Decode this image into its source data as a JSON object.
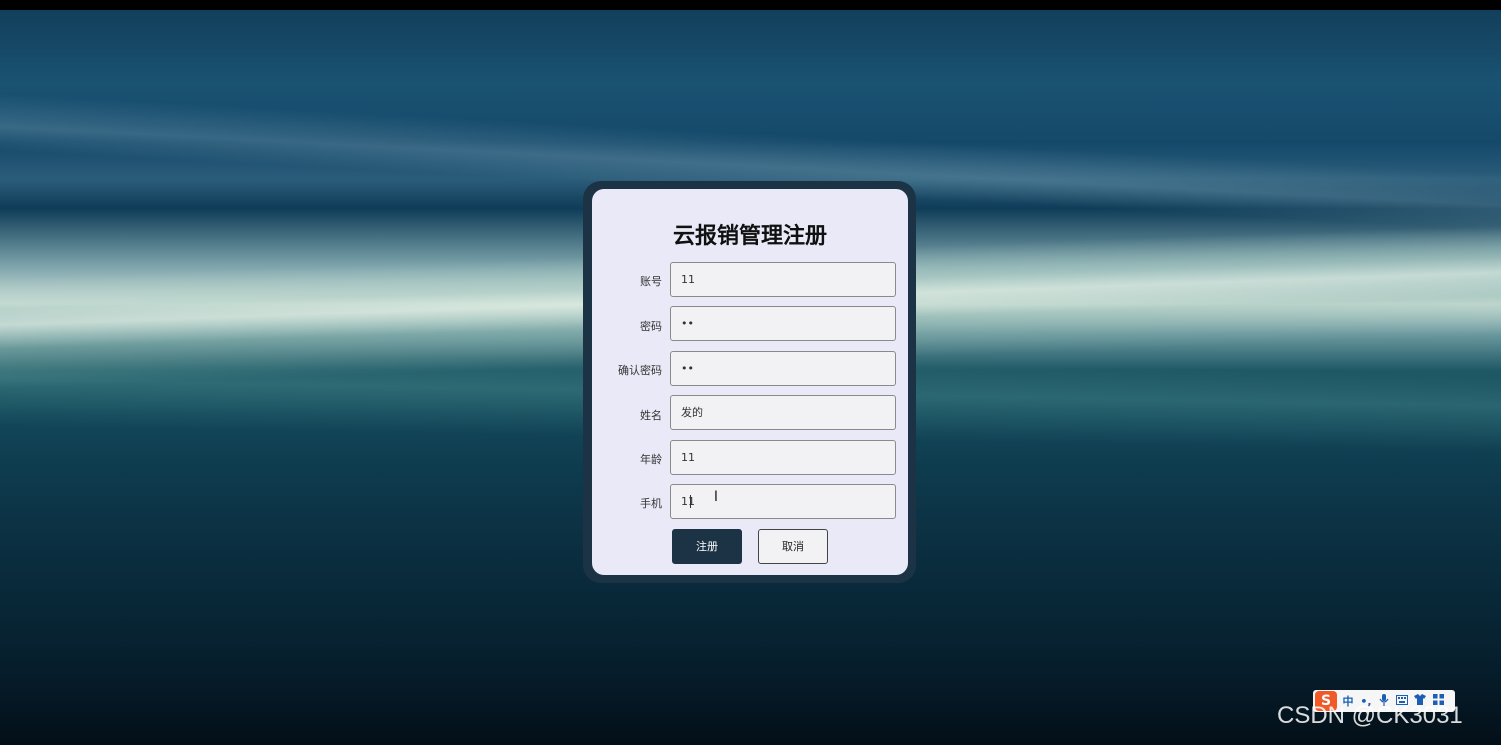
{
  "form": {
    "title": "云报销管理注册",
    "fields": [
      {
        "label": "账号",
        "value": "11"
      },
      {
        "label": "密码",
        "value": "••"
      },
      {
        "label": "确认密码",
        "value": "••"
      },
      {
        "label": "姓名",
        "value": "发的"
      },
      {
        "label": "年龄",
        "value": "11"
      },
      {
        "label": "手机",
        "value": "11"
      }
    ],
    "register_label": "注册",
    "cancel_label": "取消"
  },
  "ime": {
    "logo": "S",
    "mode": "中",
    "punct": "•,"
  },
  "watermark": "CSDN @CK3031",
  "colors": {
    "card_bg": "#e9e9f7",
    "frame": "#1c3346",
    "primary_button": "#1c3346"
  }
}
